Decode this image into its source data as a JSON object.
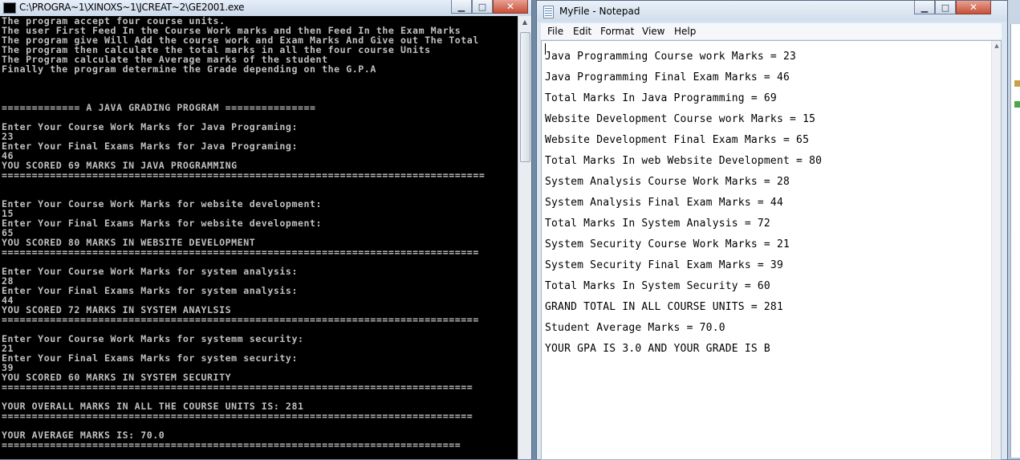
{
  "console": {
    "title": "C:\\PROGRA~1\\XINOXS~1\\JCREAT~2\\GE2001.exe",
    "lines": [
      "The program accept four course units.",
      "The user First Feed In the Course Work marks and then Feed In the Exam Marks",
      "The program give Will Add the course work and Exam Marks And Give out The Total",
      "The program then calculate the total marks in all the four course Units",
      "The Program calculate the Average marks of the student",
      "Finally the program determine the Grade depending on the G.P.A",
      "",
      "",
      "",
      "============= A JAVA GRADING PROGRAM ===============",
      "",
      "Enter Your Course Work Marks for Java Programing:",
      "23",
      "Enter Your Final Exams Marks for Java Programing:",
      "46",
      "YOU SCORED 69 MARKS IN JAVA PROGRAMMING",
      "================================================================================",
      "",
      "",
      "Enter Your Course Work Marks for website development:",
      "15",
      "Enter Your Final Exams Marks for website development:",
      "65",
      "YOU SCORED 80 MARKS IN WEBSITE DEVELOPMENT",
      "===============================================================================",
      "",
      "Enter Your Course Work Marks for system analysis:",
      "28",
      "Enter Your Final Exams Marks for system analysis:",
      "44",
      "YOU SCORED 72 MARKS IN SYSTEM ANAYLSIS",
      "===============================================================================",
      "",
      "Enter Your Course Work Marks for systemm security:",
      "21",
      "Enter Your Final Exams Marks for system security:",
      "39",
      "YOU SCORED 60 MARKS IN SYSTEM SECURITY",
      "==============================================================================",
      "",
      "YOUR OVERALL MARKS IN ALL THE COURSE UNITS IS: 281",
      "==============================================================================",
      "",
      "YOUR AVERAGE MARKS IS: 70.0",
      "============================================================================"
    ],
    "buttons": {
      "minimize": "▁",
      "maximize": "□",
      "close": "✕"
    }
  },
  "notepad": {
    "title": "MyFile - Notepad",
    "menu": [
      "File",
      "Edit",
      "Format",
      "View",
      "Help"
    ],
    "lines": [
      "Java Programming Course work Marks = 23",
      "Java Programming Final Exam Marks = 46",
      "Total Marks In Java Programming = 69",
      "Website Development Course work Marks = 15",
      "Website Development Final Exam Marks = 65",
      "Total Marks In web Website Development = 80",
      "System Analysis Course Work Marks = 28",
      "System Analysis Final Exam Marks = 44",
      "Total Marks In System Analysis = 72",
      "System Security Course Work Marks = 21",
      "System Security Final Exam Marks = 39",
      "Total Marks In System Security = 60",
      "GRAND TOTAL IN ALL COURSE UNITS = 281",
      "Student Average Marks = 70.0",
      "YOUR GPA IS 3.0 AND YOUR GRADE IS B"
    ],
    "buttons": {
      "minimize": "▁",
      "maximize": "□",
      "close": "✕"
    }
  }
}
